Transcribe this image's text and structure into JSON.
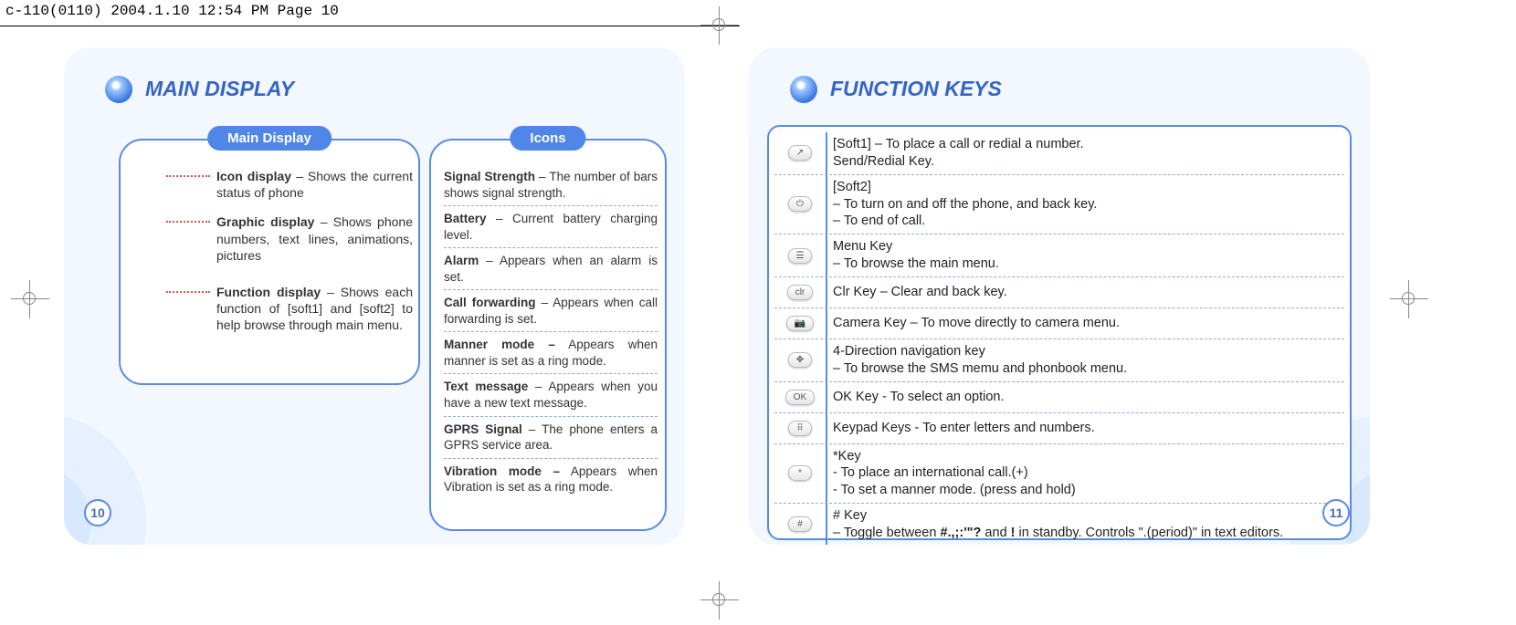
{
  "crop": "c-110(0110)  2004.1.10  12:54 PM  Page 10",
  "left": {
    "heading": "MAIN DISPLAY",
    "subheading1": "Main Display",
    "subheading2": "Icons",
    "page_num": "10",
    "display_items": [
      {
        "bold": "Icon display",
        "rest": " – Shows the current status of phone"
      },
      {
        "bold": "Graphic display",
        "rest": " – Shows phone numbers, text lines, animations, pictures"
      },
      {
        "bold": "Function display",
        "rest": " – Shows each function of [soft1] and [soft2] to help browse through main menu."
      }
    ],
    "icons": [
      {
        "bold": "Signal Strength",
        "rest": " – The number of bars shows signal strength."
      },
      {
        "bold": "Battery",
        "rest": " – Current battery charg­ing level."
      },
      {
        "bold": "Alarm",
        "rest": " – Appears when an alarm is set."
      },
      {
        "bold": "Call forwarding",
        "rest": " – Appears when call forwarding is set."
      },
      {
        "bold": "Manner mode –",
        "rest": " Appears when manner is set as a ring mode."
      },
      {
        "bold": "Text message",
        "rest": " – Appears when you have a new text message."
      },
      {
        "bold": "GPRS Signal",
        "rest": " – The phone enters a GPRS service area."
      },
      {
        "bold": "Vibration mode –",
        "rest": " Appears when Vibration is set as a ring mode."
      }
    ]
  },
  "right": {
    "heading": "FUNCTION KEYS",
    "page_num": "11",
    "rows": [
      {
        "icon": "↗",
        "lines": [
          "[Soft1] – To place a call or redial a number.",
          "Send/Redial Key."
        ]
      },
      {
        "icon": "⏻",
        "lines": [
          "[Soft2]",
          " – To turn on and off the phone, and back key.",
          " – To end of call."
        ]
      },
      {
        "icon": "☰",
        "lines": [
          "Menu Key",
          " – To browse the main menu."
        ]
      },
      {
        "icon": "clr",
        "lines": [
          "Clr Key – Clear and back key."
        ]
      },
      {
        "icon": "📷",
        "lines": [
          "Camera Key – To move directly to camera menu."
        ]
      },
      {
        "icon": "✥",
        "lines": [
          "4-Direction navigation key",
          " – To browse the SMS memu and phonbook menu."
        ]
      },
      {
        "icon": "OK",
        "lines": [
          "OK Key - To select an option."
        ]
      },
      {
        "icon": "⠿",
        "lines": [
          "Keypad Keys - To enter letters and numbers."
        ]
      },
      {
        "icon": "*",
        "lines": [
          "*Key",
          "- To place an international call.(+)",
          "- To set a manner mode. (press and hold)"
        ]
      },
      {
        "icon": "#",
        "lines_html": "# Key<br>– Toggle between <b>#.,;:'\"?</b> and <b>!</b> in standby. Controls \".(period)\" in text editors."
      }
    ]
  }
}
